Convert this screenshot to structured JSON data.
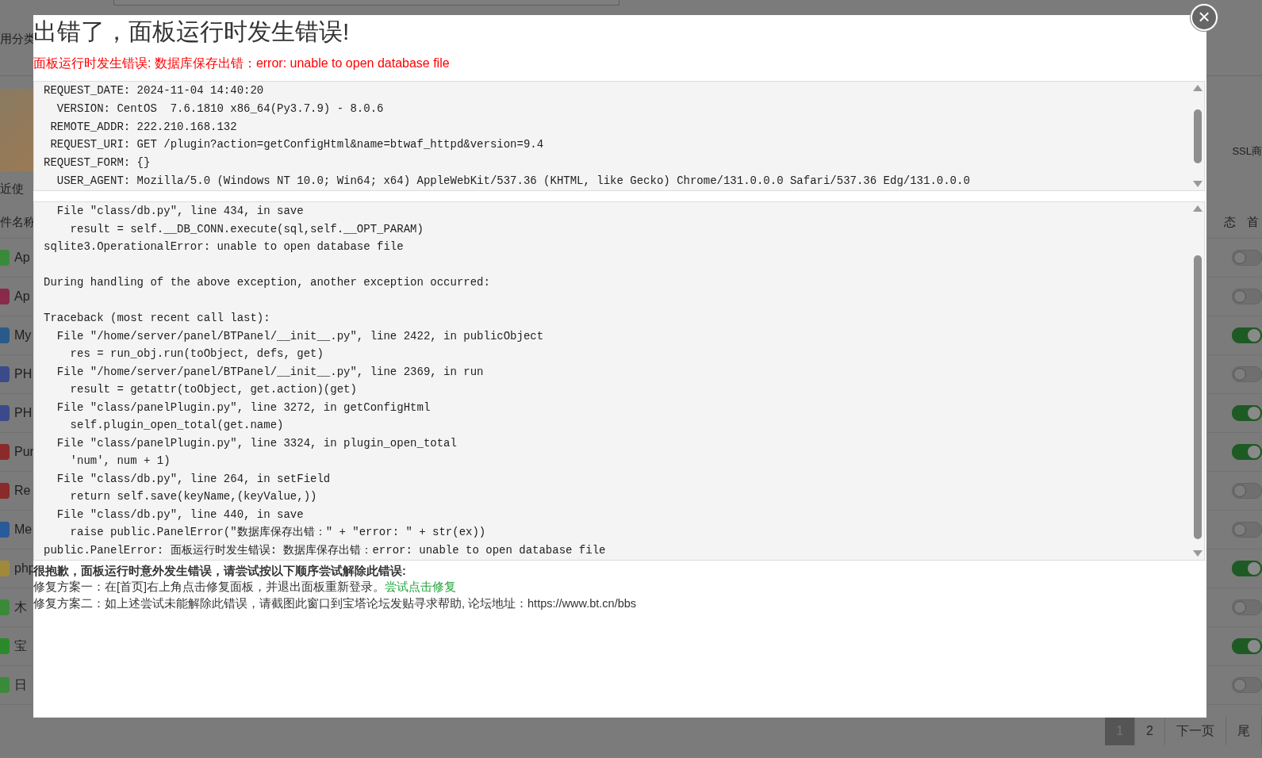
{
  "background_page": {
    "category_label": "用分类",
    "banner_text": "SSL商",
    "recent_label": "近使",
    "table": {
      "columns": [
        {
          "label": "件名称"
        },
        {
          "label": "态"
        },
        {
          "label": "首"
        }
      ],
      "rows": [
        {
          "name": "Ap",
          "on": false
        },
        {
          "name": "Ap",
          "on": false
        },
        {
          "name": "My",
          "on": true
        },
        {
          "name": "PH",
          "on": false
        },
        {
          "name": "PH",
          "on": true
        },
        {
          "name": "Pur",
          "on": true
        },
        {
          "name": "Re",
          "on": false
        },
        {
          "name": "Me",
          "on": false
        },
        {
          "name": "php",
          "on": true
        },
        {
          "name": "木",
          "on": false
        },
        {
          "name": "宝",
          "on": true
        },
        {
          "name": "日",
          "on": false
        }
      ]
    },
    "pagination": [
      {
        "label": "1",
        "selected": true
      },
      {
        "label": "2",
        "selected": false
      },
      {
        "label": "下一页",
        "selected": false
      },
      {
        "label": "尾",
        "selected": false
      }
    ]
  },
  "dialog": {
    "title": "出错了，面板运行时发生错误!",
    "close": "×",
    "message": "面板运行时发生错误: 数据库保存出错：error: unable to open database file",
    "request_info": [
      "REQUEST_DATE: 2024-11-04 14:40:20",
      "  VERSION: CentOS  7.6.1810 x86_64(Py3.7.9) - 8.0.6",
      " REMOTE_ADDR: 222.210.168.132",
      " REQUEST_URI: GET /plugin?action=getConfigHtml&name=btwaf_httpd&version=9.4",
      "REQUEST_FORM: {}",
      "  USER_AGENT: Mozilla/5.0 (Windows NT 10.0; Win64; x64) AppleWebKit/537.36 (KHTML, like Gecko) Chrome/131.0.0.0 Safari/537.36 Edg/131.0.0.0"
    ],
    "traceback": [
      [
        "  File \"class/db.py\", line 434, in save",
        "    result = self.__DB_CONN.execute(sql,self.__OPT_PARAM)",
        "sqlite3.OperationalError: unable to open database file"
      ],
      [
        "During handling of the above exception, another exception occurred:"
      ],
      [
        "Traceback (most recent call last):",
        "  File \"/home/server/panel/BTPanel/__init__.py\", line 2422, in publicObject",
        "    res = run_obj.run(toObject, defs, get)",
        "  File \"/home/server/panel/BTPanel/__init__.py\", line 2369, in run",
        "    result = getattr(toObject, get.action)(get)",
        "  File \"class/panelPlugin.py\", line 3272, in getConfigHtml",
        "    self.plugin_open_total(get.name)",
        "  File \"class/panelPlugin.py\", line 3324, in plugin_open_total",
        "    'num', num + 1)",
        "  File \"class/db.py\", line 264, in setField",
        "    return self.save(keyName,(keyValue,))",
        "  File \"class/db.py\", line 440, in save",
        "    raise public.PanelError(\"数据库保存出错：\" + \"error: \" + str(ex))",
        "public.PanelError: 面板运行时发生错误: 数据库保存出错：error: unable to open database file"
      ]
    ],
    "help_heading": "很抱歉，面板运行时意外发生错误，请尝试按以下顺序尝试解除此错误:",
    "fix_one": {
      "text": "修复方案一：在[首页]右上角点击修复面板，并退出面板重新登录。",
      "link": "尝试点击修复"
    },
    "fix_two": "修复方案二：如上述尝试未能解除此错误，请截图此窗口到宝塔论坛发贴寻求帮助, 论坛地址：https://www.bt.cn/bbs"
  }
}
